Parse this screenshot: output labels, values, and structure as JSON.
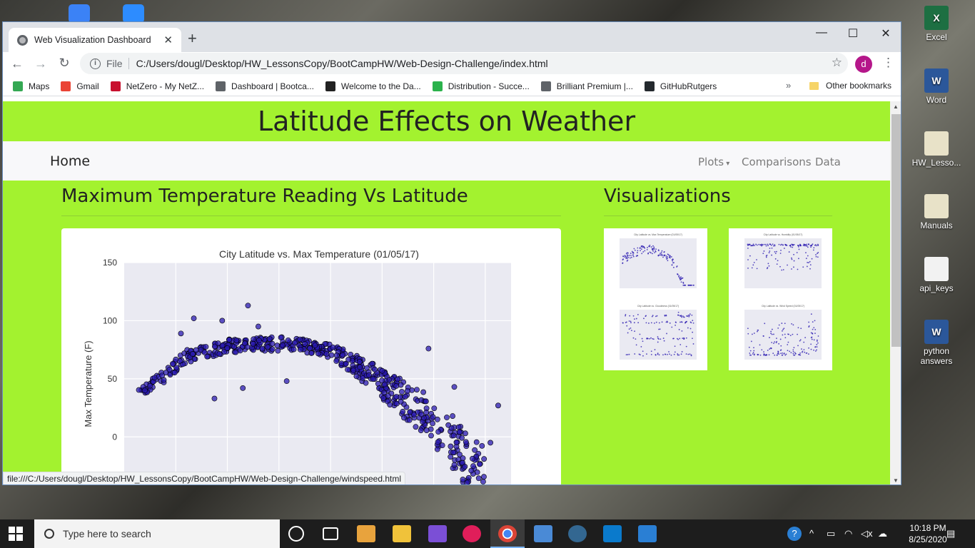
{
  "desktop": {
    "icons": [
      {
        "name": "excel-icon",
        "label": "Excel",
        "color": "#1d6f42",
        "glyph": "X"
      },
      {
        "name": "word-icon",
        "label": "Word",
        "color": "#2b579a",
        "glyph": "W"
      },
      {
        "name": "hw-lessons-icon",
        "label": "HW_Lesso...",
        "color": "#e8e2c8",
        "glyph": ""
      },
      {
        "name": "manuals-icon",
        "label": "Manuals",
        "color": "#e8e2c8",
        "glyph": ""
      },
      {
        "name": "api-keys-icon",
        "label": "api_keys",
        "color": "#f2f2f2",
        "glyph": ""
      },
      {
        "name": "python-answers-icon",
        "label": "python answers",
        "color": "#2b579a",
        "glyph": "W"
      }
    ]
  },
  "browser": {
    "tab_title": "Web Visualization Dashboard",
    "tab_close": "✕",
    "new_tab": "+",
    "minimize": "—",
    "maximize": "☐",
    "close": "✕",
    "back": "←",
    "forward": "→",
    "reload": "↻",
    "info": "i",
    "scheme": "File",
    "url": "C:/Users/dougl/Desktop/HW_LessonsCopy/BootCampHW/Web-Design-Challenge/index.html",
    "star": "☆",
    "avatar_letter": "d",
    "menu": "⋮",
    "bookmarks": [
      {
        "label": "Maps",
        "color": "#34a853"
      },
      {
        "label": "Gmail",
        "color": "#ea4335"
      },
      {
        "label": "NetZero - My NetZ...",
        "color": "#c8102e"
      },
      {
        "label": "Dashboard | Bootca...",
        "color": "#5f6368"
      },
      {
        "label": "Welcome to the Da...",
        "color": "#222222"
      },
      {
        "label": "Distribution - Succe...",
        "color": "#2bb24c"
      },
      {
        "label": "Brilliant Premium |...",
        "color": "#5f6368"
      },
      {
        "label": "GitHubRutgers",
        "color": "#24292e"
      }
    ],
    "more_bookmarks": "»",
    "other_bookmarks": "Other bookmarks",
    "status_url": "file:///C:/Users/dougl/Desktop/HW_LessonsCopy/BootCampHW/Web-Design-Challenge/windspeed.html"
  },
  "page": {
    "banner": "Latitude Effects on Weather",
    "nav": {
      "home": "Home",
      "plots": "Plots",
      "comparisons": "Comparisons",
      "data": "Data"
    },
    "main_heading": "Maximum Temperature Reading Vs Latitude",
    "side_heading": "Visualizations",
    "background_color": "#a3f22f"
  },
  "chart_data": {
    "type": "scatter",
    "title": "City Latitude vs. Max Temperature (01/05/17)",
    "xlabel": "",
    "ylabel": "Max Temperature (F)",
    "yticks": [
      "150",
      "100",
      "50",
      "0"
    ],
    "ylim": [
      -60,
      150
    ],
    "xlim": [
      -60,
      90
    ],
    "grid": true,
    "marker_color": "#2a1ab0",
    "background": "#eaeaf2",
    "envelope": [
      {
        "x": -55,
        "y": 40
      },
      {
        "x": -45,
        "y": 50
      },
      {
        "x": -40,
        "y": 62
      },
      {
        "x": -35,
        "y": 70
      },
      {
        "x": -28,
        "y": 74
      },
      {
        "x": -20,
        "y": 78
      },
      {
        "x": -12,
        "y": 80
      },
      {
        "x": -5,
        "y": 80
      },
      {
        "x": 2,
        "y": 80
      },
      {
        "x": 8,
        "y": 79
      },
      {
        "x": 15,
        "y": 77
      },
      {
        "x": 22,
        "y": 72
      },
      {
        "x": 28,
        "y": 64
      },
      {
        "x": 34,
        "y": 55
      },
      {
        "x": 40,
        "y": 46
      },
      {
        "x": 45,
        "y": 38
      },
      {
        "x": 50,
        "y": 30
      },
      {
        "x": 55,
        "y": 22
      },
      {
        "x": 60,
        "y": 12
      },
      {
        "x": 65,
        "y": 2
      },
      {
        "x": 70,
        "y": -12
      },
      {
        "x": 75,
        "y": -25
      },
      {
        "x": 80,
        "y": -35
      }
    ],
    "outliers": [
      {
        "x": -33,
        "y": 102
      },
      {
        "x": -22,
        "y": 100
      },
      {
        "x": -12,
        "y": 113
      },
      {
        "x": -8,
        "y": 95
      },
      {
        "x": -38,
        "y": 89
      },
      {
        "x": -25,
        "y": 33
      },
      {
        "x": -14,
        "y": 42
      },
      {
        "x": -50,
        "y": 44
      },
      {
        "x": 58,
        "y": 76
      },
      {
        "x": 68,
        "y": 43
      },
      {
        "x": 85,
        "y": 27
      },
      {
        "x": 82,
        "y": -5
      },
      {
        "x": 3,
        "y": 48
      },
      {
        "x": -52,
        "y": 40
      }
    ]
  },
  "thumbnails": [
    {
      "name": "thumb-max-temp",
      "title": "City Latitude vs. Max Temperature (01/05/17)",
      "pattern": "arc"
    },
    {
      "name": "thumb-humidity",
      "title": "City Latitude vs. Humidity (01/05/17)",
      "pattern": "top"
    },
    {
      "name": "thumb-cloudiness",
      "title": "City Latitude vs. Cloudiness (01/05/17)",
      "pattern": "bands"
    },
    {
      "name": "thumb-wind-speed",
      "title": "City Latitude vs. Wind Speed (01/05/17)",
      "pattern": "low"
    }
  ],
  "taskbar": {
    "search_placeholder": "Type here to search",
    "time": "10:18 PM",
    "date": "8/25/2020"
  }
}
